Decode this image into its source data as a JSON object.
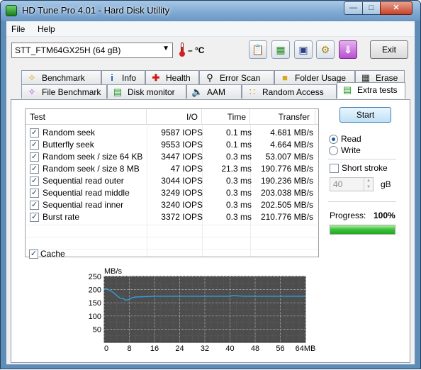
{
  "window": {
    "title": "HD Tune Pro 4.01 - Hard Disk Utility"
  },
  "menu": {
    "file": "File",
    "help": "Help"
  },
  "toolbar": {
    "drive": "STT_FTM64GX25H (64 gB)",
    "temperature": "– °C",
    "exit_label": "Exit"
  },
  "tabs_row1": [
    {
      "label": "Benchmark"
    },
    {
      "label": "Info"
    },
    {
      "label": "Health"
    },
    {
      "label": "Error Scan"
    },
    {
      "label": "Folder Usage"
    },
    {
      "label": "Erase"
    }
  ],
  "tabs_row2": [
    {
      "label": "File Benchmark"
    },
    {
      "label": "Disk monitor"
    },
    {
      "label": "AAM"
    },
    {
      "label": "Random Access"
    },
    {
      "label": "Extra tests"
    }
  ],
  "results": {
    "headers": {
      "test": "Test",
      "io": "I/O",
      "time": "Time",
      "transfer": "Transfer"
    },
    "rows": [
      {
        "name": "Random seek",
        "io": "9587 IOPS",
        "time": "0.1 ms",
        "transfer": "4.681 MB/s",
        "checked": true
      },
      {
        "name": "Butterfly seek",
        "io": "9553 IOPS",
        "time": "0.1 ms",
        "transfer": "4.664 MB/s",
        "checked": true
      },
      {
        "name": "Random seek / size 64 KB",
        "io": "3447 IOPS",
        "time": "0.3 ms",
        "transfer": "53.007 MB/s",
        "checked": true
      },
      {
        "name": "Random seek / size 8 MB",
        "io": "47 IOPS",
        "time": "21.3 ms",
        "transfer": "190.776 MB/s",
        "checked": true
      },
      {
        "name": "Sequential read outer",
        "io": "3044 IOPS",
        "time": "0.3 ms",
        "transfer": "190.236 MB/s",
        "checked": true
      },
      {
        "name": "Sequential read middle",
        "io": "3249 IOPS",
        "time": "0.3 ms",
        "transfer": "203.038 MB/s",
        "checked": true
      },
      {
        "name": "Sequential read inner",
        "io": "3240 IOPS",
        "time": "0.3 ms",
        "transfer": "202.505 MB/s",
        "checked": true
      },
      {
        "name": "Burst rate",
        "io": "3372 IOPS",
        "time": "0.3 ms",
        "transfer": "210.776 MB/s",
        "checked": true
      }
    ]
  },
  "controls": {
    "start_label": "Start",
    "read_label": "Read",
    "write_label": "Write",
    "mode_selected": "Read",
    "short_stroke_label": "Short stroke",
    "short_stroke_checked": false,
    "short_stroke_value": "40",
    "short_stroke_unit": "gB",
    "progress_label": "Progress:",
    "progress_text": "100%",
    "progress_value": 100,
    "cache_label": "Cache",
    "cache_checked": true
  },
  "colors": {
    "chart_line": "#2e9fe0",
    "chart_grid": "#ffffff",
    "chart_bg": "#4d4d4d",
    "progress": "#2fb82f"
  },
  "chart_data": {
    "type": "line",
    "ylabel": "MB/s",
    "xlabel": "",
    "ylim": [
      0,
      250
    ],
    "xlim": [
      0,
      64
    ],
    "x_tick_labels": [
      "0",
      "8",
      "16",
      "24",
      "32",
      "40",
      "48",
      "56",
      "64MB"
    ],
    "y_tick_labels": [
      "250",
      "200",
      "150",
      "100",
      "50"
    ],
    "x_ticks": [
      0,
      8,
      16,
      24,
      32,
      40,
      48,
      56,
      64
    ],
    "y_ticks": [
      250,
      200,
      150,
      100,
      50
    ],
    "grid": true,
    "series": [
      {
        "x": [
          0,
          0.5,
          1,
          1.5,
          2,
          3,
          4,
          5,
          6,
          7,
          8,
          9,
          10,
          12,
          14,
          16,
          20,
          24,
          28,
          32,
          36,
          40,
          41,
          44,
          48,
          52,
          56,
          60,
          64
        ],
        "values": [
          200,
          205,
          202,
          198,
          196,
          188,
          178,
          168,
          166,
          160,
          163,
          170,
          172,
          173,
          174,
          175,
          175,
          175,
          175,
          175,
          175,
          175,
          178,
          175,
          175,
          175,
          175,
          175,
          175
        ]
      }
    ]
  }
}
